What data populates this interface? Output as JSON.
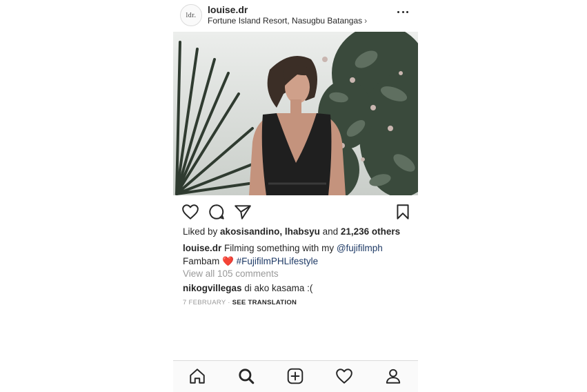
{
  "post": {
    "avatar_text": "ldr.",
    "username": "louise.dr",
    "location": "Fortune Island Resort, Nasugbu Batangas",
    "location_chevron": "›"
  },
  "likes": {
    "prefix": "Liked by ",
    "user1": "akosisandino",
    "sep": ", ",
    "user2": "lhabsyu",
    "mid": " and ",
    "count": "21,236 others"
  },
  "caption": {
    "username": "louise.dr",
    "text1": " Filming something with my ",
    "mention": "@fujifilmph",
    "text2": "Fambam ",
    "emoji": "❤️",
    "hashtag": "#FujifilmPHLifestyle"
  },
  "comments": {
    "view_all": "View all 105 comments",
    "items": [
      {
        "username": "nikogvillegas",
        "text": " di ako kasama :("
      }
    ]
  },
  "meta": {
    "date": "7 FEBRUARY",
    "dot": " · ",
    "see_translation": "SEE TRANSLATION"
  },
  "icons": {
    "header": [
      "more-icon"
    ],
    "actions": [
      "heart-icon",
      "comment-icon",
      "share-icon",
      "bookmark-icon"
    ],
    "tabs": [
      "home-icon",
      "search-icon",
      "add-icon",
      "activity-icon",
      "profile-icon"
    ]
  },
  "colors": {
    "text": "#262626",
    "muted": "#999999",
    "link": "#1e3a66",
    "heart": "#d6202a",
    "divider": "#dbdbdb"
  }
}
